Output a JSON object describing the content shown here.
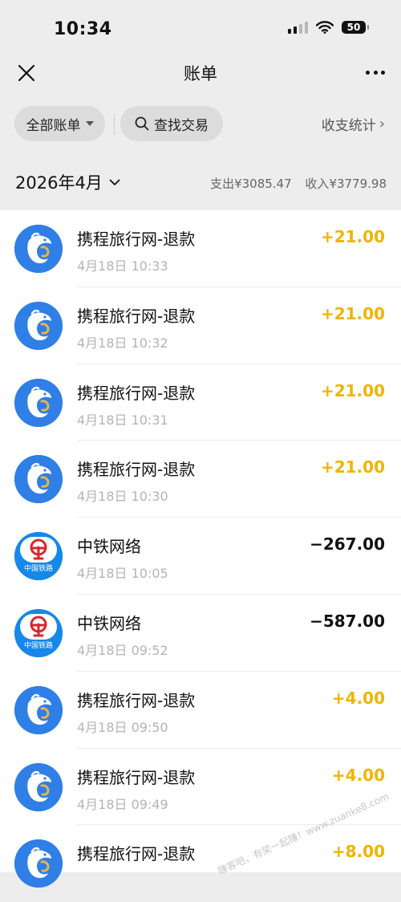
{
  "status_bar": {
    "time": "10:34",
    "battery": "50"
  },
  "nav": {
    "title": "账单"
  },
  "filters": {
    "all_label": "全部账单",
    "search_label": "查找交易",
    "stats_label": "收支统计"
  },
  "month": {
    "label": "2026年4月",
    "expense": "支出¥3085.47",
    "income": "收入¥3779.98"
  },
  "transactions": [
    {
      "title": "携程旅行网-退款",
      "time": "4月18日 10:33",
      "amount": "+21.00",
      "icon": "ctrip-dolphin-icon"
    },
    {
      "title": "携程旅行网-退款",
      "time": "4月18日 10:32",
      "amount": "+21.00",
      "icon": "ctrip-dolphin-icon"
    },
    {
      "title": "携程旅行网-退款",
      "time": "4月18日 10:31",
      "amount": "+21.00",
      "icon": "ctrip-dolphin-icon"
    },
    {
      "title": "携程旅行网-退款",
      "time": "4月18日 10:30",
      "amount": "+21.00",
      "icon": "ctrip-dolphin-icon"
    },
    {
      "title": "中铁网络",
      "time": "4月18日 10:05",
      "amount": "−267.00",
      "icon": "china-railway-icon",
      "icon_text": "中国铁路"
    },
    {
      "title": "中铁网络",
      "time": "4月18日 09:52",
      "amount": "−587.00",
      "icon": "china-railway-icon",
      "icon_text": "中国铁路"
    },
    {
      "title": "携程旅行网-退款",
      "time": "4月18日 09:50",
      "amount": "+4.00",
      "icon": "ctrip-dolphin-icon"
    },
    {
      "title": "携程旅行网-退款",
      "time": "4月18日 09:49",
      "amount": "+4.00",
      "icon": "ctrip-dolphin-icon"
    },
    {
      "title": "携程旅行网-退款",
      "time": "",
      "amount": "+8.00",
      "icon": "ctrip-dolphin-icon"
    }
  ],
  "watermark": "赚客吧，有奖一起赚！www.zuanke8.com",
  "colors": {
    "income": "#f0b400",
    "expense": "#111111",
    "ctrip_blue": "#2f7fe6",
    "rail_blue": "#1688e8",
    "rail_red": "#d8262c"
  }
}
